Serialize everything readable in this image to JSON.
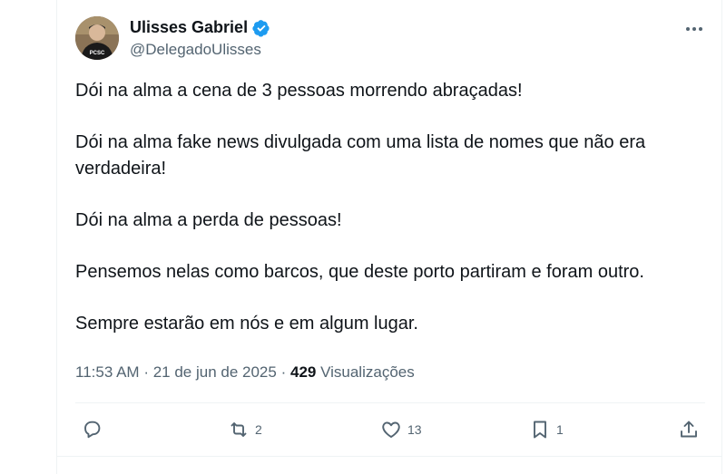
{
  "author": {
    "name": "Ulisses Gabriel",
    "handle": "@DelegadoUlisses",
    "avatar_badge": "PCSC"
  },
  "tweet": {
    "paragraphs": [
      "Dói na alma a cena de 3 pessoas morrendo abraçadas!",
      "Dói na alma fake news divulgada com uma lista de nomes que não era verdadeira!",
      "Dói na alma a perda de pessoas!",
      "Pensemos nelas como barcos, que deste porto partiram e foram outro.",
      "Sempre estarão em nós e em algum lugar."
    ],
    "time": "11:53 AM",
    "date": "21 de jun de 2025",
    "separator": "·",
    "views_count": "429",
    "views_label": "Visualizações"
  },
  "actions": {
    "reply_count": "",
    "retweet_count": "2",
    "like_count": "13",
    "bookmark_count": "1"
  },
  "colors": {
    "verified": "#1d9bf0",
    "text_primary": "#0f1419",
    "text_secondary": "#536471",
    "divider": "#eff3f4"
  },
  "icons": {
    "verified": "verified-badge-icon",
    "more": "more-dots-icon",
    "reply": "reply-icon",
    "retweet": "retweet-icon",
    "like": "heart-icon",
    "bookmark": "bookmark-icon",
    "share": "share-icon"
  }
}
